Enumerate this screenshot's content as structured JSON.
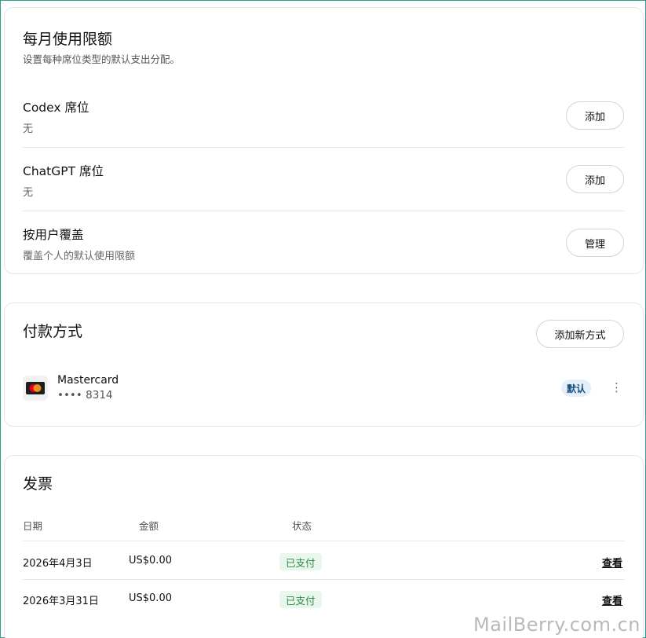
{
  "limits": {
    "title": "每月使用限额",
    "subtitle": "设置每种席位类型的默认支出分配。",
    "rows": [
      {
        "title": "Codex 席位",
        "sub": "无",
        "button": "添加"
      },
      {
        "title": "ChatGPT 席位",
        "sub": "无",
        "button": "添加"
      },
      {
        "title": "按用户覆盖",
        "sub": "覆盖个人的默认使用限额",
        "button": "管理"
      }
    ]
  },
  "payment": {
    "title": "付款方式",
    "add_button": "添加新方式",
    "card": {
      "brand": "Mastercard",
      "masked": "•••• 8314",
      "badge": "默认",
      "menu_icon": "more-vertical-icon"
    }
  },
  "invoices": {
    "title": "发票",
    "headers": {
      "date": "日期",
      "amount": "金额",
      "status": "状态"
    },
    "rows": [
      {
        "date": "2026年4月3日",
        "amount": "US$0.00",
        "status": "已支付",
        "action": "查看"
      },
      {
        "date": "2026年3月31日",
        "amount": "US$0.00",
        "status": "已支付",
        "action": "查看"
      }
    ]
  },
  "watermark": "MailBerry.com.cn",
  "colors": {
    "paid_bg": "#e8f6ec",
    "paid_text": "#2a8a46",
    "badge_bg": "#e3f0fb",
    "mc_red": "#eb001b",
    "mc_yellow": "#f79e1b"
  }
}
